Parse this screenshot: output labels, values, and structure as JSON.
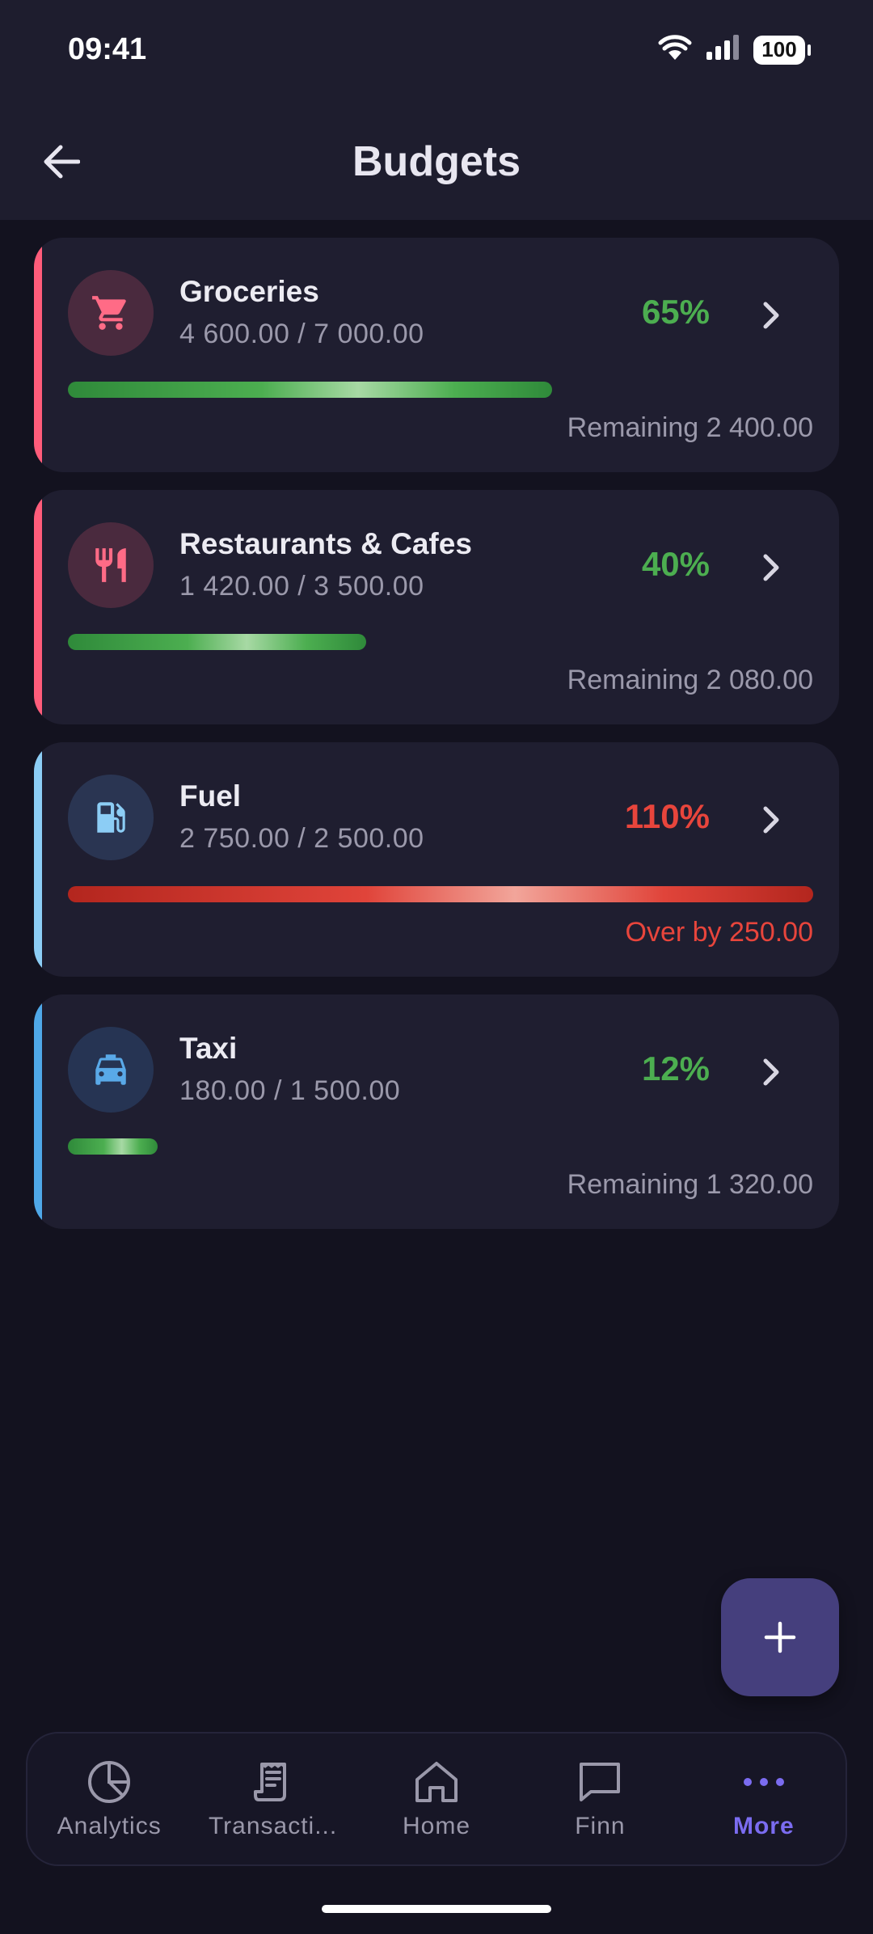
{
  "status_bar": {
    "time": "09:41",
    "battery": "100"
  },
  "header": {
    "title": "Budgets"
  },
  "budgets": [
    {
      "name": "Groceries",
      "amount": "4 600.00 / 7 000.00",
      "percent": "65%",
      "progress": 0.65,
      "footer": "Remaining 2 400.00",
      "status": "ok",
      "icon": "cart-icon",
      "accent": "#ff5c7a",
      "icon_bg": "#4a2a3e",
      "icon_color": "#ff6b86"
    },
    {
      "name": "Restaurants & Cafes",
      "amount": "1 420.00 / 3 500.00",
      "percent": "40%",
      "progress": 0.4,
      "footer": "Remaining 2 080.00",
      "status": "ok",
      "icon": "fork-knife-icon",
      "accent": "#ff5c7a",
      "icon_bg": "#4a2a3e",
      "icon_color": "#ff6b86"
    },
    {
      "name": "Fuel",
      "amount": "2 750.00 / 2 500.00",
      "percent": "110%",
      "progress": 1.1,
      "footer": "Over by 250.00",
      "status": "over",
      "icon": "fuel-pump-icon",
      "accent": "#8ccdf5",
      "icon_bg": "#2a3552",
      "icon_color": "#8ccdf5"
    },
    {
      "name": "Taxi",
      "amount": "180.00 / 1 500.00",
      "percent": "12%",
      "progress": 0.12,
      "footer": "Remaining 1 320.00",
      "status": "ok",
      "icon": "taxi-icon",
      "accent": "#4fa8e8",
      "icon_bg": "#263453",
      "icon_color": "#59a9e8"
    }
  ],
  "colors": {
    "ok": "#4cae50",
    "over": "#e8453c",
    "active_nav": "#7b6cf0"
  },
  "bottom_nav": [
    {
      "label": "Analytics",
      "icon": "pie-chart-icon",
      "active": false
    },
    {
      "label": "Transacti...",
      "icon": "receipt-icon",
      "active": false
    },
    {
      "label": "Home",
      "icon": "home-icon",
      "active": false
    },
    {
      "label": "Finn",
      "icon": "chat-icon",
      "active": false
    },
    {
      "label": "More",
      "icon": "more-dots-icon",
      "active": true
    }
  ]
}
